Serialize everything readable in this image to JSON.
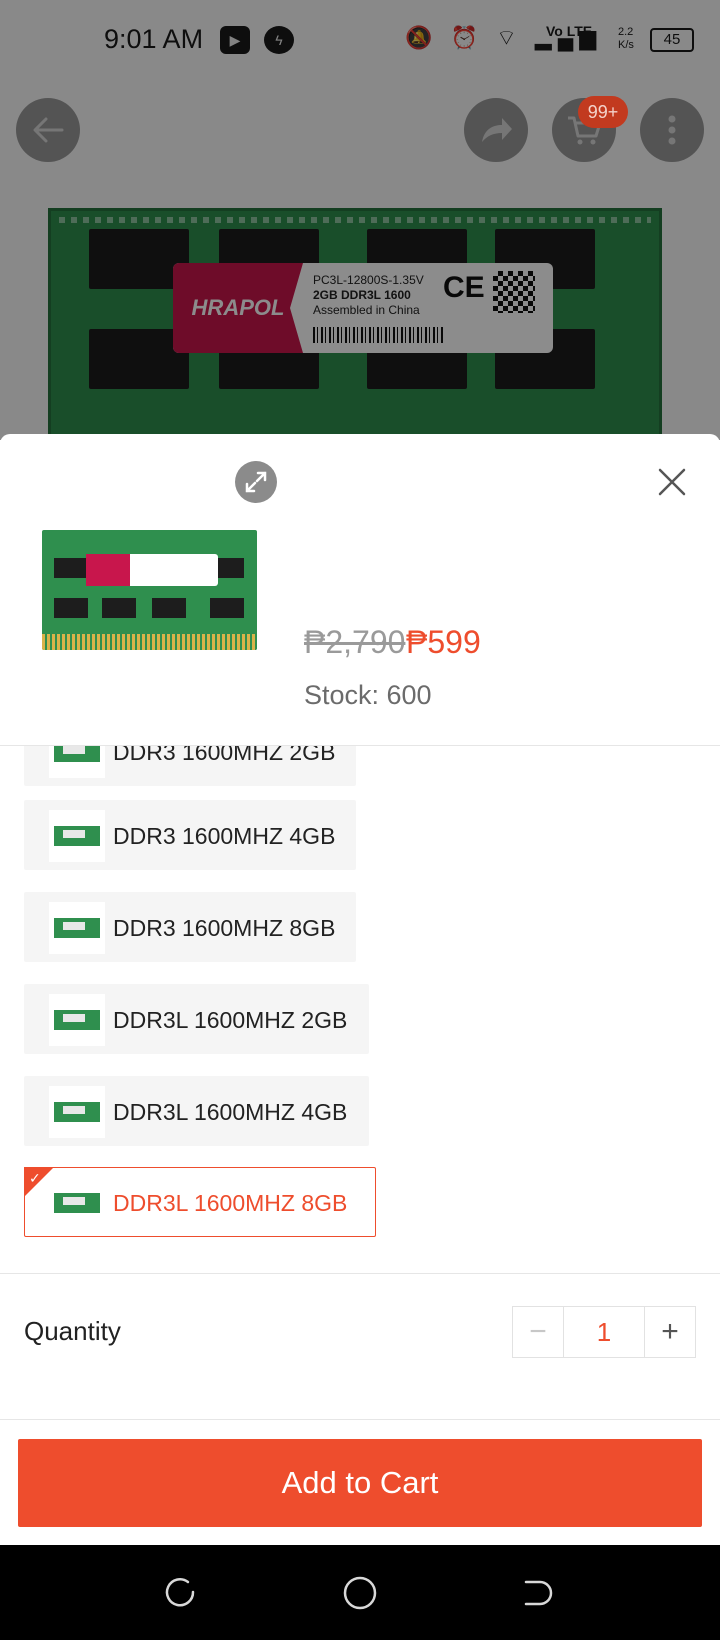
{
  "status_bar": {
    "time": "9:01 AM",
    "icons": [
      "youtube-icon",
      "messenger-icon",
      "mute-icon",
      "alarm-icon",
      "wifi-icon",
      "signal-icon"
    ],
    "network": "Vo LTE",
    "speed": "2.2 K/s",
    "battery": "45"
  },
  "top_bar": {
    "cart_badge": "99+"
  },
  "product_image": {
    "brand": "HRAPOL",
    "spec_line1": "PC3L-12800S-1.35V",
    "spec_line2": "2GB DDR3L 1600",
    "spec_line3": "Assembled in China",
    "mark": "CE"
  },
  "sheet": {
    "original_price": "₱2,790",
    "sale_price": "₱599",
    "stock": "Stock: 600",
    "variants": [
      {
        "label": "DDR3 1600MHZ 2GB",
        "selected": false
      },
      {
        "label": "DDR3 1600MHZ 4GB",
        "selected": false
      },
      {
        "label": "DDR3 1600MHZ 8GB",
        "selected": false
      },
      {
        "label": "DDR3L 1600MHZ 2GB",
        "selected": false
      },
      {
        "label": "DDR3L 1600MHZ 4GB",
        "selected": false
      },
      {
        "label": "DDR3L 1600MHZ  8GB",
        "selected": true
      }
    ],
    "quantity_label": "Quantity",
    "quantity_value": "1",
    "minus": "−",
    "plus": "+",
    "add_to_cart": "Add to Cart"
  },
  "colors": {
    "accent": "#ee4d2d",
    "ram_green": "#2f8f4e",
    "brand_red": "#c8164c"
  }
}
